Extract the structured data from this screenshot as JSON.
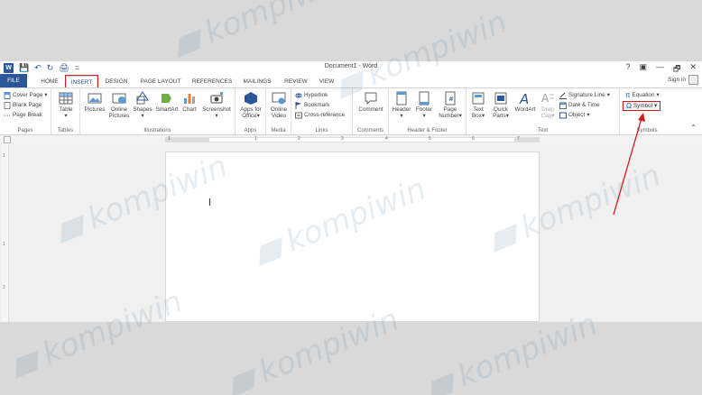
{
  "window": {
    "title": "Document1 - Word",
    "controls": [
      "?",
      "▣",
      "—",
      "🗗",
      "✕"
    ]
  },
  "qat": {
    "save": "💾",
    "undo": "↶",
    "redo": "↻",
    "print": "🖨",
    "more": "="
  },
  "tabs": [
    {
      "label": "FILE"
    },
    {
      "label": "HOME"
    },
    {
      "label": "INSERT"
    },
    {
      "label": "DESIGN"
    },
    {
      "label": "PAGE LAYOUT"
    },
    {
      "label": "REFERENCES"
    },
    {
      "label": "MAILINGS"
    },
    {
      "label": "REVIEW"
    },
    {
      "label": "VIEW"
    }
  ],
  "signin": "Sign in",
  "ribbon": {
    "pages": {
      "cover": "Cover Page",
      "blank": "Blank Page",
      "break": "Page Break",
      "label": "Pages"
    },
    "tables": {
      "table": "Table",
      "label": "Tables"
    },
    "illustrations": {
      "pictures": "Pictures",
      "online1": "Online",
      "online2": "Pictures",
      "shapes": "Shapes",
      "smartart": "SmartArt",
      "chart": "Chart",
      "screenshot": "Screenshot",
      "label": "Illustrations"
    },
    "apps": {
      "l1": "Apps for",
      "l2": "Office",
      "label": "Apps"
    },
    "media": {
      "l1": "Online",
      "l2": "Video",
      "label": "Media"
    },
    "links": {
      "hyperlink": "Hyperlink",
      "bookmark": "Bookmark",
      "cross": "Cross-reference",
      "label": "Links"
    },
    "comments": {
      "comment": "Comment",
      "label": "Comments"
    },
    "hf": {
      "header": "Header",
      "footer": "Footer",
      "page1": "Page",
      "page2": "Number",
      "label": "Header & Footer"
    },
    "text": {
      "tb1": "Text",
      "tb2": "Box",
      "qp1": "Quick",
      "qp2": "Parts",
      "wordart": "WordArt",
      "dc1": "Drop",
      "dc2": "Cap",
      "sig": "Signature Line",
      "date": "Date & Time",
      "object": "Object",
      "label": "Text"
    },
    "symbols": {
      "equation": "Equation",
      "symbol": "Symbol",
      "label": "Symbols"
    }
  },
  "ruler": {
    "numbers": [
      "1",
      "1",
      "2",
      "3",
      "4",
      "5",
      "6",
      "7"
    ]
  },
  "vruler": {
    "numbers": [
      "1",
      "1",
      "2"
    ]
  },
  "watermark": "kompiwin",
  "colors": {
    "accent": "#2b579a",
    "highlight": "#d11a1a"
  }
}
